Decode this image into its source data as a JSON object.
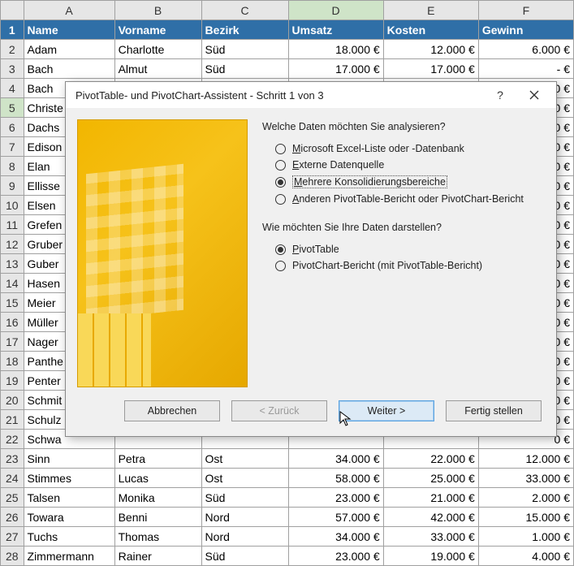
{
  "columns": [
    "A",
    "B",
    "C",
    "D",
    "E",
    "F"
  ],
  "selectedCol": "D",
  "selectedRow": 5,
  "header": {
    "A": "Name",
    "B": "Vorname",
    "C": "Bezirk",
    "D": "Umsatz",
    "E": "Kosten",
    "F": "Gewinn"
  },
  "rows": [
    {
      "n": 2,
      "A": "Adam",
      "B": "Charlotte",
      "C": "Süd",
      "D": "18.000 €",
      "E": "12.000 €",
      "F": "6.000 €"
    },
    {
      "n": 3,
      "A": "Bach",
      "B": "Almut",
      "C": "Süd",
      "D": "17.000 €",
      "E": "17.000 €",
      "F": "-     €"
    },
    {
      "n": 4,
      "A": "Bach",
      "B": "",
      "C": "",
      "D": "",
      "E": "",
      "F": "0 €"
    },
    {
      "n": 5,
      "A": "Christe",
      "B": "",
      "C": "",
      "D": "",
      "E": "",
      "F": "0 €"
    },
    {
      "n": 6,
      "A": "Dachs",
      "B": "",
      "C": "",
      "D": "",
      "E": "",
      "F": "0 €"
    },
    {
      "n": 7,
      "A": "Edison",
      "B": "",
      "C": "",
      "D": "",
      "E": "",
      "F": "0 €"
    },
    {
      "n": 8,
      "A": "Elan",
      "B": "",
      "C": "",
      "D": "",
      "E": "",
      "F": "0 €"
    },
    {
      "n": 9,
      "A": "Ellisse",
      "B": "",
      "C": "",
      "D": "",
      "E": "",
      "F": "0 €"
    },
    {
      "n": 10,
      "A": "Elsen",
      "B": "",
      "C": "",
      "D": "",
      "E": "",
      "F": "0 €"
    },
    {
      "n": 11,
      "A": "Grefen",
      "B": "",
      "C": "",
      "D": "",
      "E": "",
      "F": "0 €"
    },
    {
      "n": 12,
      "A": "Gruber",
      "B": "",
      "C": "",
      "D": "",
      "E": "",
      "F": "0 €"
    },
    {
      "n": 13,
      "A": "Guber",
      "B": "",
      "C": "",
      "D": "",
      "E": "",
      "F": "0 €"
    },
    {
      "n": 14,
      "A": "Hasen",
      "B": "",
      "C": "",
      "D": "",
      "E": "",
      "F": "0 €"
    },
    {
      "n": 15,
      "A": "Meier",
      "B": "",
      "C": "",
      "D": "",
      "E": "",
      "F": "0 €"
    },
    {
      "n": 16,
      "A": "Müller",
      "B": "",
      "C": "",
      "D": "",
      "E": "",
      "F": "0 €"
    },
    {
      "n": 17,
      "A": "Nager",
      "B": "",
      "C": "",
      "D": "",
      "E": "",
      "F": "0 €"
    },
    {
      "n": 18,
      "A": "Panthe",
      "B": "",
      "C": "",
      "D": "",
      "E": "",
      "F": "0 €"
    },
    {
      "n": 19,
      "A": "Penter",
      "B": "",
      "C": "",
      "D": "",
      "E": "",
      "F": "0 €"
    },
    {
      "n": 20,
      "A": "Schmit",
      "B": "",
      "C": "",
      "D": "",
      "E": "",
      "F": "0 €"
    },
    {
      "n": 21,
      "A": "Schulz",
      "B": "",
      "C": "",
      "D": "",
      "E": "",
      "F": "0 €"
    },
    {
      "n": 22,
      "A": "Schwa",
      "B": "",
      "C": "",
      "D": "",
      "E": "",
      "F": "0 €"
    },
    {
      "n": 23,
      "A": "Sinn",
      "B": "Petra",
      "C": "Ost",
      "D": "34.000 €",
      "E": "22.000 €",
      "F": "12.000 €"
    },
    {
      "n": 24,
      "A": "Stimmes",
      "B": "Lucas",
      "C": "Ost",
      "D": "58.000 €",
      "E": "25.000 €",
      "F": "33.000 €"
    },
    {
      "n": 25,
      "A": "Talsen",
      "B": "Monika",
      "C": "Süd",
      "D": "23.000 €",
      "E": "21.000 €",
      "F": "2.000 €"
    },
    {
      "n": 26,
      "A": "Towara",
      "B": "Benni",
      "C": "Nord",
      "D": "57.000 €",
      "E": "42.000 €",
      "F": "15.000 €"
    },
    {
      "n": 27,
      "A": "Tuchs",
      "B": "Thomas",
      "C": "Nord",
      "D": "34.000 €",
      "E": "33.000 €",
      "F": "1.000 €"
    },
    {
      "n": 28,
      "A": "Zimmermann",
      "B": "Rainer",
      "C": "Süd",
      "D": "23.000 €",
      "E": "19.000 €",
      "F": "4.000 €"
    }
  ],
  "dialog": {
    "title": "PivotTable- und PivotChart-Assistent - Schritt 1 von 3",
    "help": "?",
    "q1": "Welche Daten möchten Sie analysieren?",
    "opts1": [
      {
        "u": "M",
        "rest": "icrosoft Excel-Liste oder -Datenbank",
        "checked": false
      },
      {
        "u": "E",
        "rest": "xterne Datenquelle",
        "checked": false
      },
      {
        "u": "M",
        "rest": "ehrere Konsolidierungsbereiche",
        "checked": true,
        "sel": true
      },
      {
        "u": "A",
        "rest": "nderen PivotTable-Bericht oder PivotChart-Bericht",
        "checked": false
      }
    ],
    "q2": "Wie möchten Sie Ihre Daten darstellen?",
    "opts2": [
      {
        "u": "P",
        "rest": "ivotTable",
        "checked": true
      },
      {
        "u": "",
        "rest": "PivotChart-Bericht (mit PivotTable-Bericht)",
        "checked": false
      }
    ],
    "buttons": {
      "cancel": "Abbrechen",
      "back": "< Zurück",
      "next": "Weiter >",
      "finish": "Fertig stellen"
    }
  }
}
